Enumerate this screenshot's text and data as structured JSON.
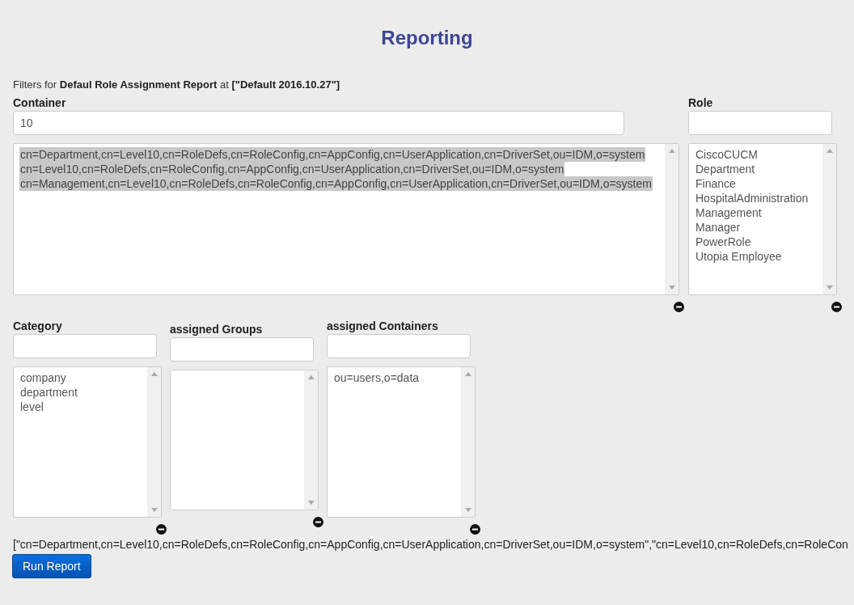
{
  "title": "Reporting",
  "filters_line": "Filters for **Defaul Role Assignment Report** at **[\"Default 2016.10.27\"]**",
  "top_row": [
    {
      "label": "Container",
      "filter_value": "10",
      "items": [
        {
          "text": "cn=Department,cn=Level10,cn=RoleDefs,cn=RoleConfig,cn=AppConfig,cn=UserApplication,cn=DriverSet,ou=IDM,o=system",
          "selected": true
        },
        {
          "text": "cn=Level10,cn=RoleDefs,cn=RoleConfig,cn=AppConfig,cn=UserApplication,cn=DriverSet,ou=IDM,o=system",
          "selected": true
        },
        {
          "text": "cn=Management,cn=Level10,cn=RoleDefs,cn=RoleConfig,cn=AppConfig,cn=UserApplication,cn=DriverSet,ou=IDM,o=system",
          "selected": true
        }
      ]
    },
    {
      "label": "Role",
      "items": [
        {
          "text": "CiscoCUCM",
          "selected": false
        },
        {
          "text": "Department",
          "selected": false
        },
        {
          "text": "Finance",
          "selected": false
        },
        {
          "text": "HospitalAdministration",
          "selected": false
        },
        {
          "text": "Management",
          "selected": false
        },
        {
          "text": "Manager",
          "selected": false
        },
        {
          "text": "PowerRole",
          "selected": false
        },
        {
          "text": "Utopia Employee",
          "selected": false
        }
      ]
    }
  ],
  "bottom_row": [
    {
      "label": "Category",
      "items": [
        {
          "text": "company",
          "selected": false
        },
        {
          "text": "department",
          "selected": false
        },
        {
          "text": "level",
          "selected": false
        }
      ]
    },
    {
      "label": "assigned Groups"
    },
    {
      "label": "assigned Containers",
      "items": [
        {
          "text": "ou=users,o=data",
          "selected": false
        }
      ]
    }
  ],
  "selection_summary": "[\"cn=Department,cn=Level10,cn=RoleDefs,cn=RoleConfig,cn=AppConfig,cn=UserApplication,cn=DriverSet,ou=IDM,o=system\",\"cn=Level10,cn=RoleDefs,cn=RoleCon",
  "run_button": "Run Report"
}
